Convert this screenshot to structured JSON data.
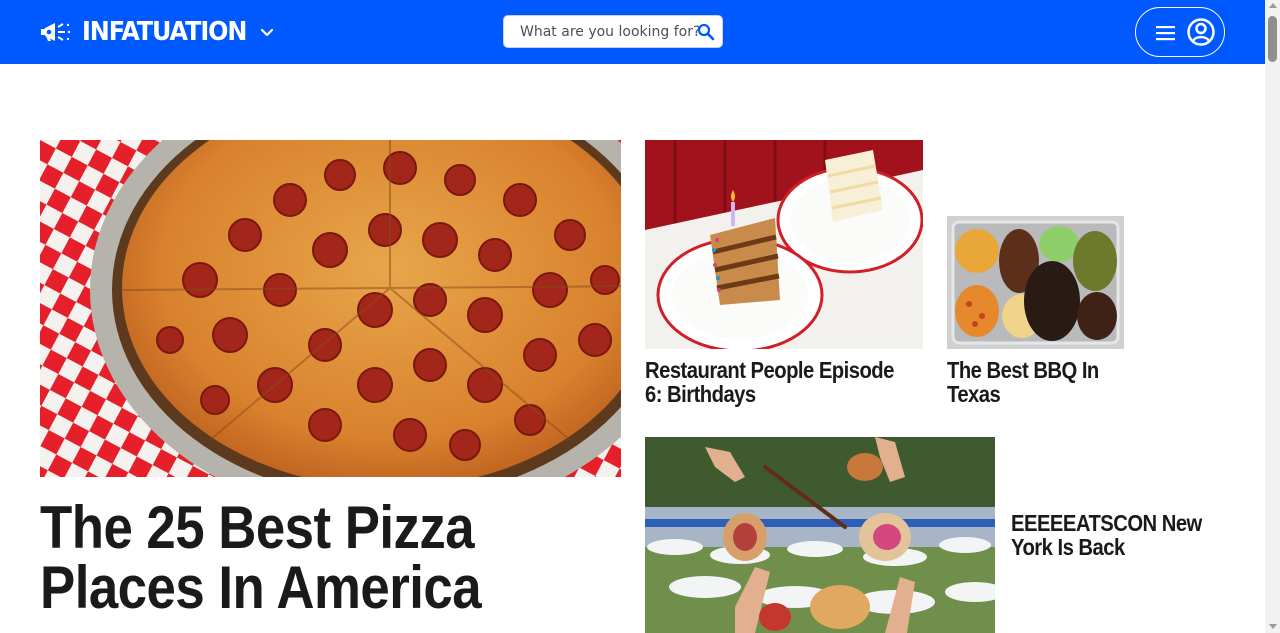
{
  "header": {
    "brand": "INFATUATION",
    "search_placeholder": "What are you looking for?"
  },
  "feature": {
    "title": "The 25 Best Pizza Places In America",
    "image_alt": "Pepperoni pizza on checkered paper"
  },
  "stories": [
    {
      "title": "Restaurant People Episode 6: Birthdays",
      "image_alt": "Slices of birthday cake with a candle"
    },
    {
      "title": "The Best BBQ In Texas",
      "image_alt": "Tray of barbecue meats and sides"
    },
    {
      "title": "EEEEEATSCON New York Is Back",
      "image_alt": "Hands holding food at an outdoor festival"
    }
  ],
  "colors": {
    "brand_blue": "#0059ff",
    "headline": "#1a1a1a",
    "white": "#ffffff"
  },
  "icons": [
    "megaphone-logo-icon",
    "chevron-down-icon",
    "search-icon",
    "hamburger-menu-icon",
    "account-icon"
  ]
}
